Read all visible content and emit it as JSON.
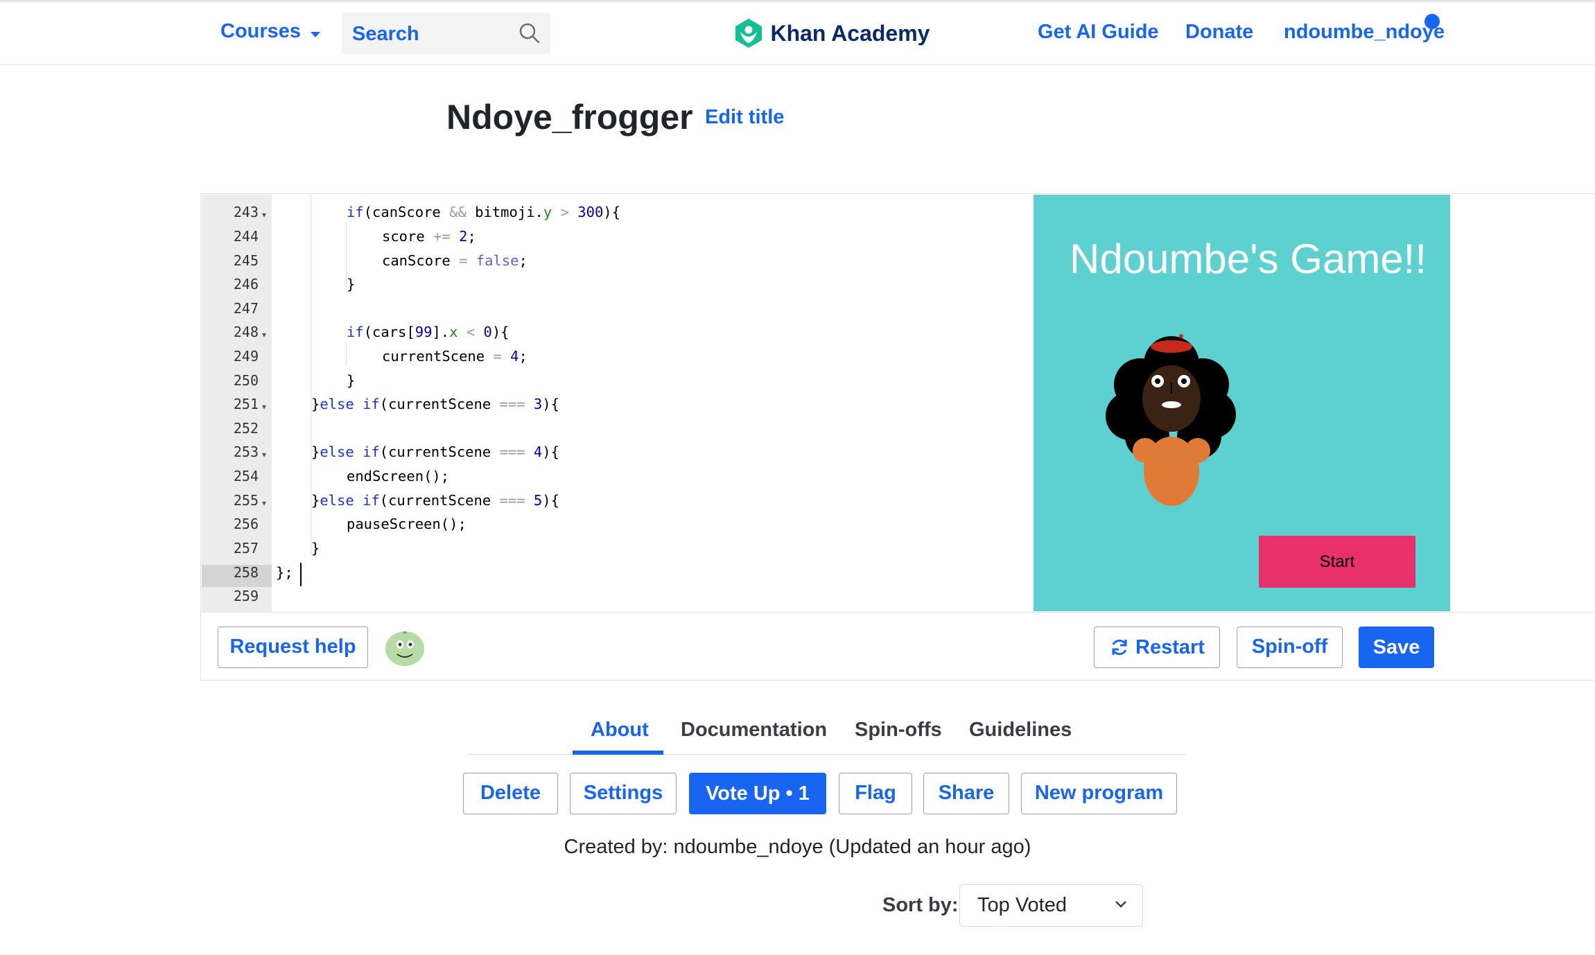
{
  "nav": {
    "courses_label": "Courses",
    "search_placeholder": "Search",
    "logo_text": "Khan Academy",
    "ai_guide_label": "Get AI Guide",
    "donate_label": "Donate",
    "username": "ndoumbe_ndoye"
  },
  "program": {
    "title": "Ndoye_frogger",
    "edit_title_label": "Edit title"
  },
  "editor": {
    "line_numbers": [
      "243",
      "244",
      "245",
      "246",
      "247",
      "248",
      "249",
      "250",
      "251",
      "252",
      "253",
      "254",
      "255",
      "256",
      "257",
      "258",
      "259"
    ],
    "lines": [
      "if(canScore && bitmoji.y > 300){",
      "score += 2;",
      "canScore = false;",
      "}",
      "",
      "if(cars[99].x < 0){",
      "currentScene = 4;",
      "}",
      "}else if(currentScene === 3){",
      "",
      "}else if(currentScene === 4){",
      "endScreen();",
      "}else if(currentScene === 5){",
      "pauseScreen();",
      "}",
      "};",
      ""
    ]
  },
  "preview": {
    "game_title": "Ndoumbe's Game!!",
    "start_label": "Start",
    "background_color": "#5dd0d0"
  },
  "toolbar": {
    "request_help_label": "Request help",
    "restart_label": "Restart",
    "spinoff_label": "Spin-off",
    "save_label": "Save"
  },
  "tabs": {
    "about": "About",
    "documentation": "Documentation",
    "spinoffs": "Spin-offs",
    "guidelines": "Guidelines"
  },
  "actions": {
    "delete": "Delete",
    "settings": "Settings",
    "vote_up": "Vote Up • 1",
    "flag": "Flag",
    "share": "Share",
    "new_program": "New program"
  },
  "meta": {
    "created_by": "Created by: ndoumbe_ndoye (Updated an hour ago)"
  },
  "sort": {
    "label": "Sort by:",
    "value": "Top Voted"
  },
  "colors": {
    "accent": "#1865f2",
    "start_button": "#e8306a"
  }
}
